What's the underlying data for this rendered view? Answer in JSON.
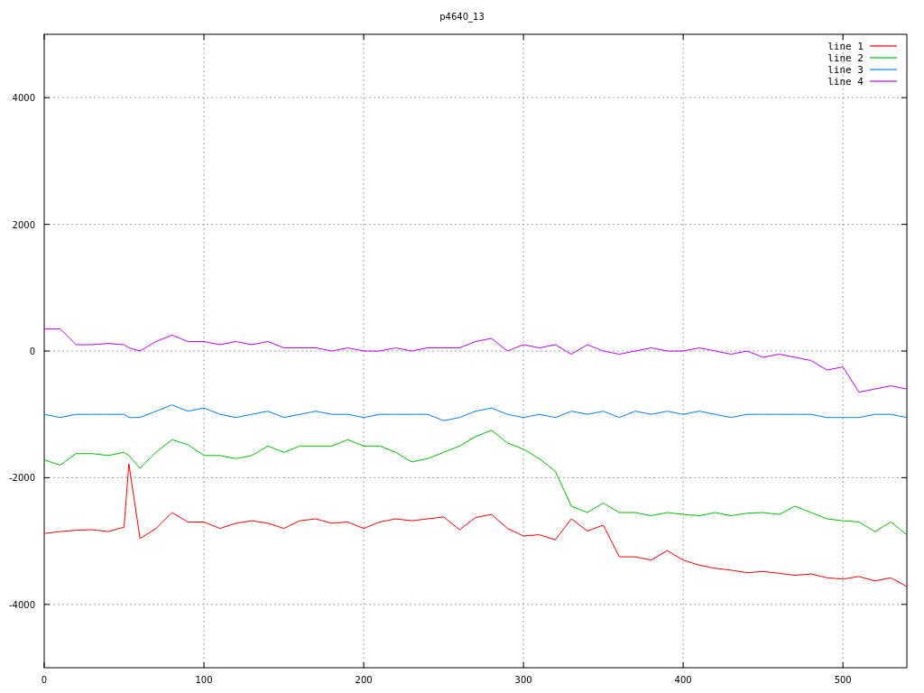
{
  "chart_data": {
    "type": "line",
    "title": "p4640_13",
    "x": [
      0,
      10,
      20,
      30,
      40,
      50,
      53,
      60,
      70,
      80,
      90,
      100,
      110,
      120,
      130,
      140,
      150,
      160,
      170,
      180,
      190,
      200,
      210,
      220,
      230,
      240,
      250,
      260,
      270,
      280,
      290,
      300,
      310,
      320,
      330,
      340,
      350,
      360,
      370,
      380,
      390,
      400,
      410,
      420,
      430,
      440,
      450,
      460,
      470,
      480,
      490,
      500,
      510,
      520,
      530,
      540
    ],
    "grid": true,
    "legend": true,
    "xlim": [
      0,
      540
    ],
    "ylim": [
      -5000,
      5000
    ],
    "xticks": [
      0,
      100,
      200,
      300,
      400,
      500
    ],
    "yticks": [
      {
        "value": -4000,
        "label": "-4000"
      },
      {
        "value": -2000,
        "label": "-2000"
      },
      0,
      2000,
      4000
    ],
    "series": [
      {
        "name": "line 1",
        "color": "#ff0000",
        "values": [
          -2880,
          -2850,
          -2830,
          -2820,
          -2850,
          -2780,
          -1780,
          -2960,
          -2800,
          -2550,
          -2700,
          -2700,
          -2800,
          -2720,
          -2680,
          -2720,
          -2800,
          -2680,
          -2650,
          -2720,
          -2700,
          -2800,
          -2700,
          -2650,
          -2680,
          -2650,
          -2620,
          -2820,
          -2630,
          -2580,
          -2800,
          -2920,
          -2900,
          -2980,
          -2650,
          -2840,
          -2750,
          -3250,
          -3250,
          -3300,
          -3150,
          -3300,
          -3380,
          -3430,
          -3460,
          -3500,
          -3480,
          -3510,
          -3540,
          -3520,
          -3580,
          -3600,
          -3560,
          -3630,
          -3580,
          -3720
        ]
      },
      {
        "name": "line 2",
        "color": "#00c000",
        "values": [
          -1720,
          -1800,
          -1620,
          -1620,
          -1650,
          -1600,
          -1650,
          -1850,
          -1600,
          -1400,
          -1480,
          -1650,
          -1650,
          -1700,
          -1650,
          -1500,
          -1600,
          -1500,
          -1500,
          -1500,
          -1400,
          -1500,
          -1500,
          -1600,
          -1750,
          -1700,
          -1600,
          -1500,
          -1350,
          -1250,
          -1450,
          -1550,
          -1700,
          -1900,
          -2450,
          -2550,
          -2400,
          -2550,
          -2550,
          -2600,
          -2550,
          -2580,
          -2600,
          -2550,
          -2600,
          -2560,
          -2550,
          -2580,
          -2450,
          -2550,
          -2650,
          -2680,
          -2700,
          -2850,
          -2700,
          -2900
        ]
      },
      {
        "name": "line 3",
        "color": "#0080ff",
        "values": [
          -1000,
          -1050,
          -1000,
          -1000,
          -1000,
          -1000,
          -1050,
          -1050,
          -950,
          -850,
          -950,
          -900,
          -1000,
          -1050,
          -1000,
          -950,
          -1050,
          -1000,
          -950,
          -1000,
          -1000,
          -1050,
          -1000,
          -1000,
          -1000,
          -1000,
          -1100,
          -1050,
          -950,
          -900,
          -1000,
          -1050,
          -1000,
          -1050,
          -950,
          -1000,
          -950,
          -1050,
          -950,
          -1000,
          -950,
          -1000,
          -950,
          -1000,
          -1050,
          -1000,
          -1000,
          -1000,
          -1000,
          -1000,
          -1050,
          -1050,
          -1050,
          -1000,
          -1000,
          -1050
        ]
      },
      {
        "name": "line 4",
        "color": "#c000ff",
        "values": [
          350,
          350,
          100,
          100,
          120,
          100,
          50,
          0,
          150,
          250,
          150,
          150,
          100,
          150,
          100,
          150,
          50,
          50,
          50,
          0,
          50,
          0,
          0,
          50,
          0,
          50,
          50,
          50,
          150,
          200,
          0,
          100,
          50,
          100,
          -50,
          100,
          0,
          -50,
          0,
          50,
          0,
          0,
          50,
          0,
          -50,
          0,
          -100,
          -50,
          -100,
          -150,
          -300,
          -250,
          -650,
          -600,
          -550,
          -600
        ]
      }
    ]
  }
}
